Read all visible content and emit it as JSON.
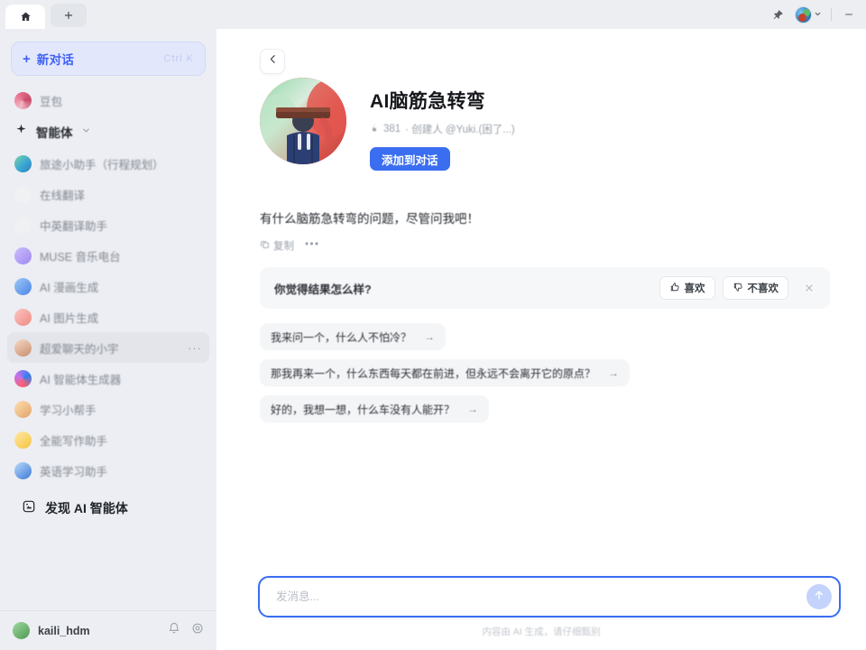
{
  "titlebar": {
    "home_tab_icon": "home-icon",
    "new_tab_icon": "plus-icon",
    "pin_icon": "pin-icon",
    "chevron_icon": "chevron-down-icon",
    "minimize_icon": "minimize-icon"
  },
  "sidebar": {
    "new_chat": {
      "label": "新对话",
      "shortcut": "Ctrl K",
      "plus": "+"
    },
    "pinned": [
      {
        "label": "豆包",
        "icon": "doubao-avatar"
      }
    ],
    "section": {
      "label": "智能体",
      "icon": "sparkle-icon",
      "chevron": "chevron-down-icon"
    },
    "items": [
      {
        "label": "旅途小助手（行程规划）",
        "icon": "travel-avatar"
      },
      {
        "label": "在线翻译",
        "icon": "translate-avatar"
      },
      {
        "label": "中英翻译助手",
        "icon": "zh-en-translate-avatar"
      },
      {
        "label": "MUSE 音乐电台",
        "icon": "muse-avatar"
      },
      {
        "label": "AI 漫画生成",
        "icon": "comic-avatar"
      },
      {
        "label": "AI 图片生成",
        "icon": "image-gen-avatar"
      },
      {
        "label": "超爱聊天的小宇",
        "icon": "xiaoyu-avatar",
        "active": true,
        "menu": "···"
      },
      {
        "label": "AI 智能体生成器",
        "icon": "agent-gen-avatar"
      },
      {
        "label": "学习小帮手",
        "icon": "study-avatar"
      },
      {
        "label": "全能写作助手",
        "icon": "writing-avatar"
      },
      {
        "label": "英语学习助手",
        "icon": "english-avatar"
      }
    ],
    "discover": {
      "label": "发现 AI 智能体",
      "icon": "discover-icon"
    },
    "footer": {
      "username": "kaili_hdm",
      "avatar": "user-avatar",
      "notification_icon": "bell-icon",
      "settings_icon": "gear-icon"
    }
  },
  "main": {
    "back_icon": "chevron-left-icon",
    "bot": {
      "avatar": "bot-avatar",
      "title": "AI脑筋急转弯",
      "stat_icon": "fire-icon",
      "stat_count": "381",
      "creator_text": "· 创建人 @Yuki.(困了...)",
      "add_button": "添加到对话"
    },
    "message": {
      "text": "有什么脑筋急转弯的问题，尽管问我吧！",
      "copy_label": "复制",
      "copy_icon": "copy-icon",
      "more_icon": "more-dots-icon"
    },
    "feedback": {
      "question": "你觉得结果怎么样?",
      "like_label": "喜欢",
      "like_icon": "thumbs-up-icon",
      "dislike_label": "不喜欢",
      "dislike_icon": "thumbs-down-icon",
      "close_icon": "close-icon"
    },
    "suggestions": [
      {
        "text": "我来问一个，什么人不怕冷？",
        "arrow": "→"
      },
      {
        "text": "那我再来一个，什么东西每天都在前进，但永远不会离开它的原点？",
        "arrow": "→"
      },
      {
        "text": "好的，我想一想，什么车没有人能开？",
        "arrow": "→"
      }
    ],
    "composer": {
      "placeholder": "发消息...",
      "value": "",
      "send_icon": "send-arrow-icon"
    },
    "footnote": "内容由 AI 生成，请仔细甄别"
  },
  "colors": {
    "accent": "#3a6df0",
    "new_chat_text": "#3f62f5",
    "sidebar_bg": "#eceef3",
    "main_bg": "#ffffff"
  }
}
